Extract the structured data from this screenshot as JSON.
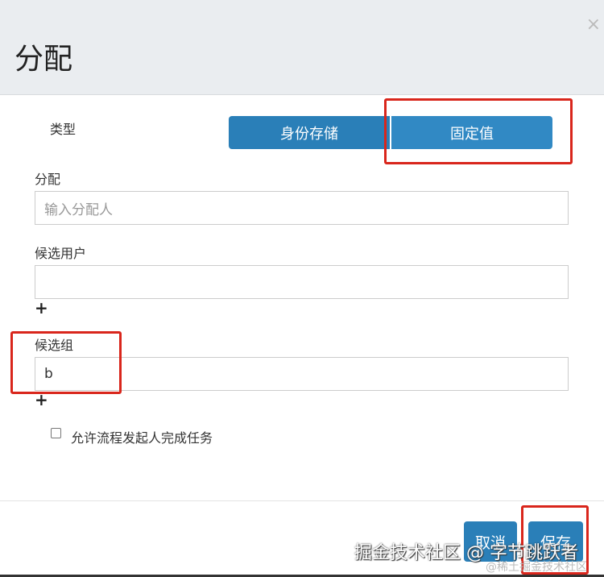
{
  "dialog": {
    "title": "分配",
    "close": "×"
  },
  "type": {
    "label": "类型",
    "options": [
      "身份存储",
      "固定值"
    ],
    "selected": "固定值"
  },
  "assignee": {
    "label": "分配",
    "placeholder": "输入分配人",
    "value": ""
  },
  "candidate_users": {
    "label": "候选用户",
    "value": "",
    "add": "+"
  },
  "candidate_groups": {
    "label": "候选组",
    "value": "b",
    "add": "+"
  },
  "allow_initiator": {
    "label": "允许流程发起人完成任务",
    "checked": false
  },
  "footer": {
    "cancel": "取消",
    "save": "保存"
  },
  "watermark": {
    "main": "掘金技术社区 @ 字节跳跃者",
    "sub": "@稀土掘金技术社区"
  }
}
